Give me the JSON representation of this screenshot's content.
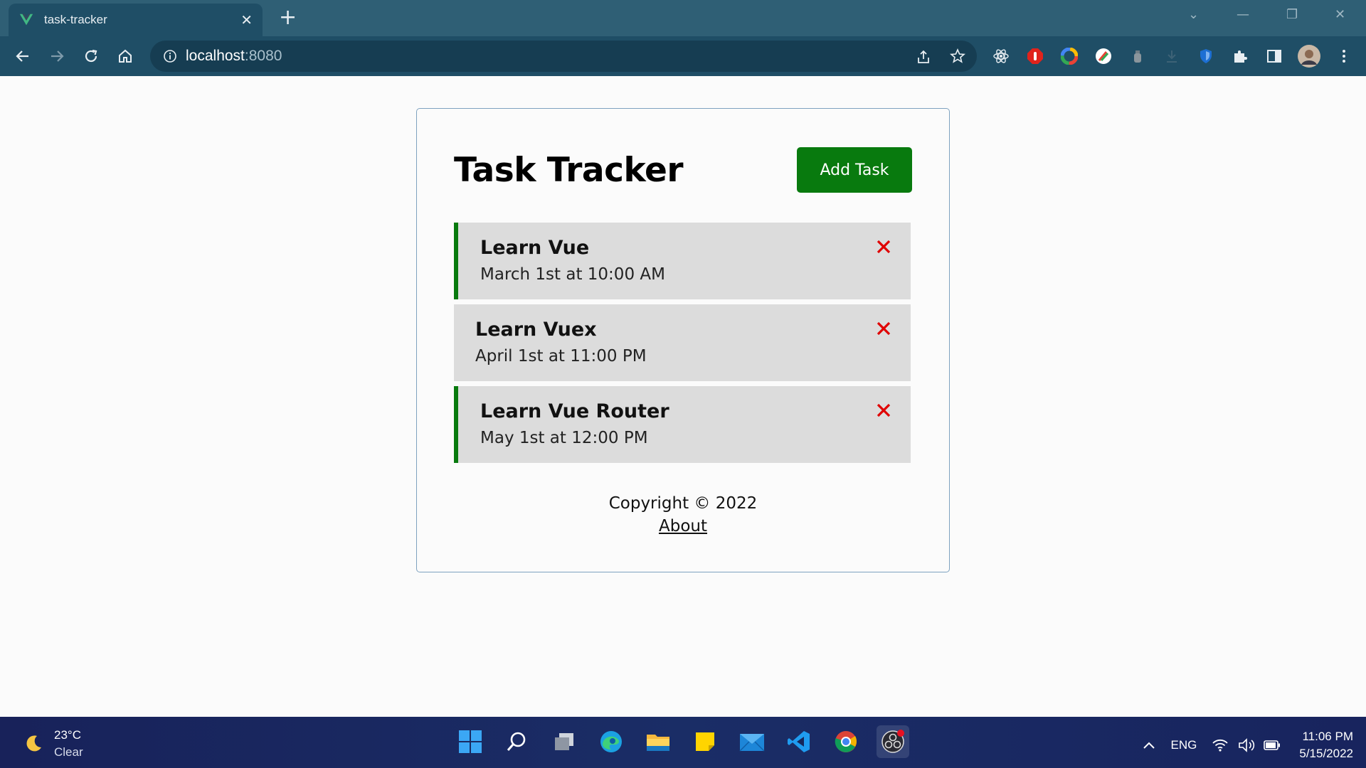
{
  "browser": {
    "tab_title": "task-tracker",
    "url_host": "localhost",
    "url_port": ":8080"
  },
  "app": {
    "title": "Task Tracker",
    "add_button_label": "Add Task",
    "tasks": [
      {
        "text": "Learn Vue",
        "day": "March 1st at 10:00 AM",
        "reminder": true
      },
      {
        "text": "Learn Vuex",
        "day": "April 1st at 11:00 PM",
        "reminder": false
      },
      {
        "text": "Learn Vue Router",
        "day": "May 1st at 12:00 PM",
        "reminder": true
      }
    ],
    "footer": {
      "copyright": "Copyright © 2022",
      "about_link": "About"
    }
  },
  "taskbar": {
    "weather_temp": "23°C",
    "weather_desc": "Clear",
    "language": "ENG",
    "time": "11:06 PM",
    "date": "5/15/2022"
  },
  "colors": {
    "accent_green": "#087a0e",
    "delete_red": "#e00000",
    "task_bg": "#dcdcdc"
  }
}
